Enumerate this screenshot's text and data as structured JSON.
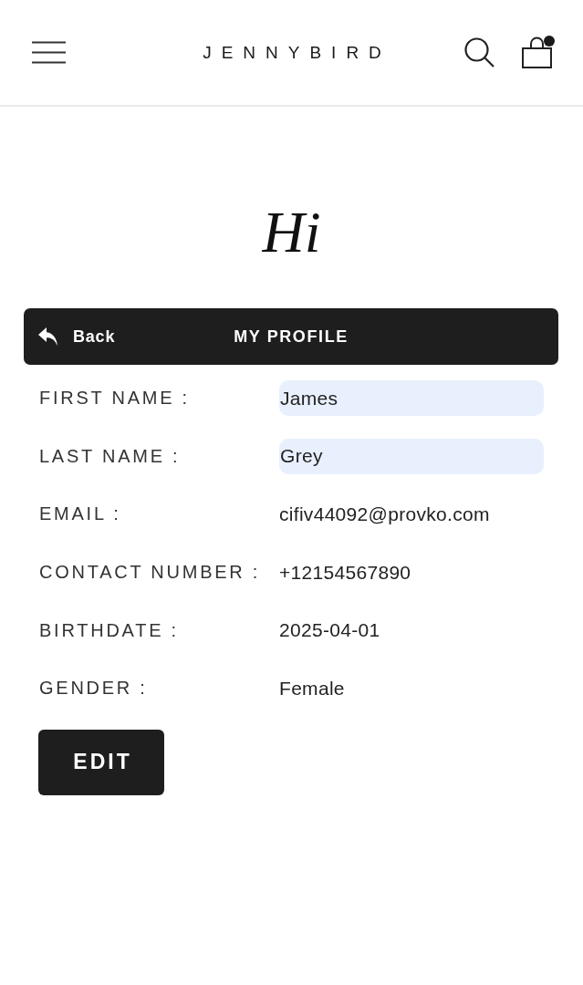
{
  "header": {
    "logo": "JENNYBIRD",
    "cart_dot": true
  },
  "greeting": "Hi",
  "profile_bar": {
    "back_label": "Back",
    "title": "MY PROFILE"
  },
  "fields": [
    {
      "label": "FIRST NAME :",
      "value": "James",
      "kind": "input"
    },
    {
      "label": "LAST NAME :",
      "value": "Grey",
      "kind": "input"
    },
    {
      "label": "EMAIL :",
      "value": "cifiv44092@provko.com",
      "kind": "text"
    },
    {
      "label": "CONTACT NUMBER :",
      "value": "+12154567890",
      "kind": "text"
    },
    {
      "label": "BIRTHDATE :",
      "value": "2025-04-01",
      "kind": "text"
    },
    {
      "label": "GENDER :",
      "value": "Female",
      "kind": "text"
    }
  ],
  "edit_button": "EDIT"
}
